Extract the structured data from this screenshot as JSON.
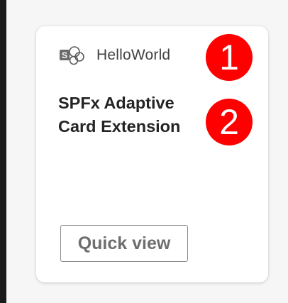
{
  "card": {
    "app_name": "HelloWorld",
    "app_icon": "sharepoint-icon",
    "title": "SPFx Adaptive Card Extension",
    "action_label": "Quick view"
  },
  "annotations": [
    {
      "label": "1",
      "color": "#ff0000"
    },
    {
      "label": "2",
      "color": "#ff0000"
    }
  ]
}
